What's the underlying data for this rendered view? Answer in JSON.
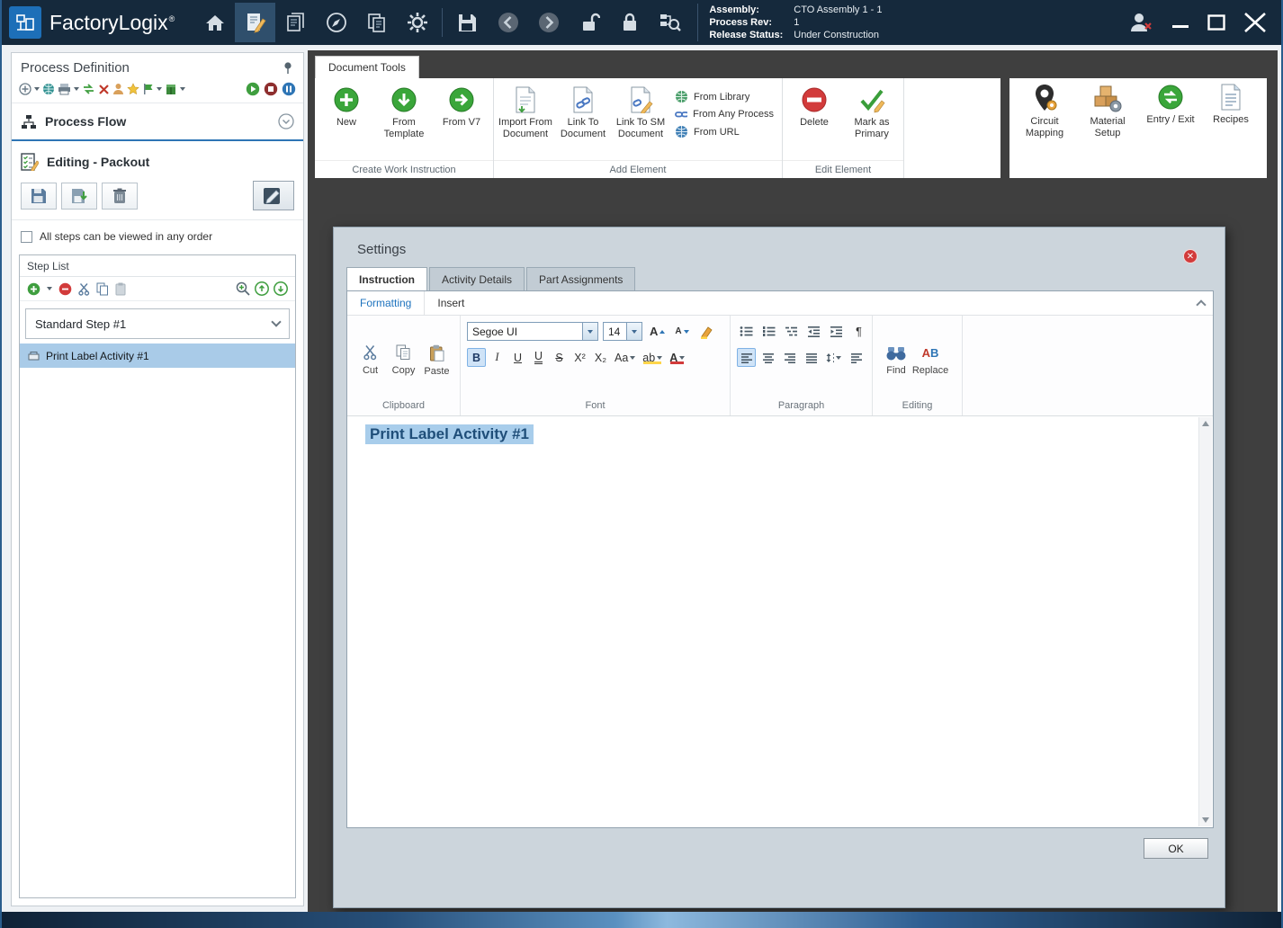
{
  "titlebar": {
    "app_name": "FactoryLogix",
    "registered": "®",
    "assembly_label": "Assembly:",
    "assembly_value": "CTO Assembly 1 - 1",
    "process_rev_label": "Process Rev:",
    "process_rev_value": "1",
    "release_status_label": "Release Status:",
    "release_status_value": "Under Construction"
  },
  "sidebar": {
    "title": "Process Definition",
    "process_flow_label": "Process Flow",
    "editing_label": "Editing - Packout",
    "order_checkbox_label": "All steps can be viewed in any order",
    "step_list_title": "Step List",
    "step_label": "Standard Step #1",
    "activity_label": "Print Label Activity #1"
  },
  "document_tools": {
    "tab_label": "Document Tools",
    "create_group_label": "Create Work Instruction",
    "new_label": "New",
    "from_template_label": "From Template",
    "from_v7_label": "From V7",
    "add_group_label": "Add Element",
    "import_from_document_label": "Import From Document",
    "link_to_document_label": "Link To Document",
    "link_to_sm_document_label": "Link To SM Document",
    "from_library_label": "From Library",
    "from_any_process_label": "From Any Process",
    "from_url_label": "From URL",
    "edit_group_label": "Edit Element",
    "delete_label": "Delete",
    "mark_as_primary_label": "Mark as Primary",
    "circuit_mapping_label": "Circuit Mapping",
    "material_setup_label": "Material Setup",
    "entry_exit_label": "Entry / Exit",
    "recipes_label": "Recipes"
  },
  "settings": {
    "title": "Settings",
    "tab_instruction": "Instruction",
    "tab_activity_details": "Activity Details",
    "tab_part_assignments": "Part Assignments",
    "ok_label": "OK",
    "editor": {
      "tab_formatting": "Formatting",
      "tab_insert": "Insert",
      "font_name": "Segoe UI",
      "font_size": "14",
      "group_clipboard": "Clipboard",
      "group_font": "Font",
      "group_paragraph": "Paragraph",
      "group_editing": "Editing",
      "cut_label": "Cut",
      "copy_label": "Copy",
      "paste_label": "Paste",
      "find_label": "Find",
      "replace_label": "Replace",
      "content_text": "Print Label Activity #1"
    }
  },
  "glyphs": {
    "bold": "B",
    "italic": "I",
    "underline": "U",
    "double_underline": "U",
    "strikethrough": "S",
    "superscript": "X²",
    "subscript": "X₂",
    "change_case": "Aa",
    "highlight": "ab",
    "font_color": "A",
    "pilcrow": "¶",
    "grow_font": "A",
    "shrink_font": "A",
    "replace_a": "A",
    "replace_b": "B"
  }
}
